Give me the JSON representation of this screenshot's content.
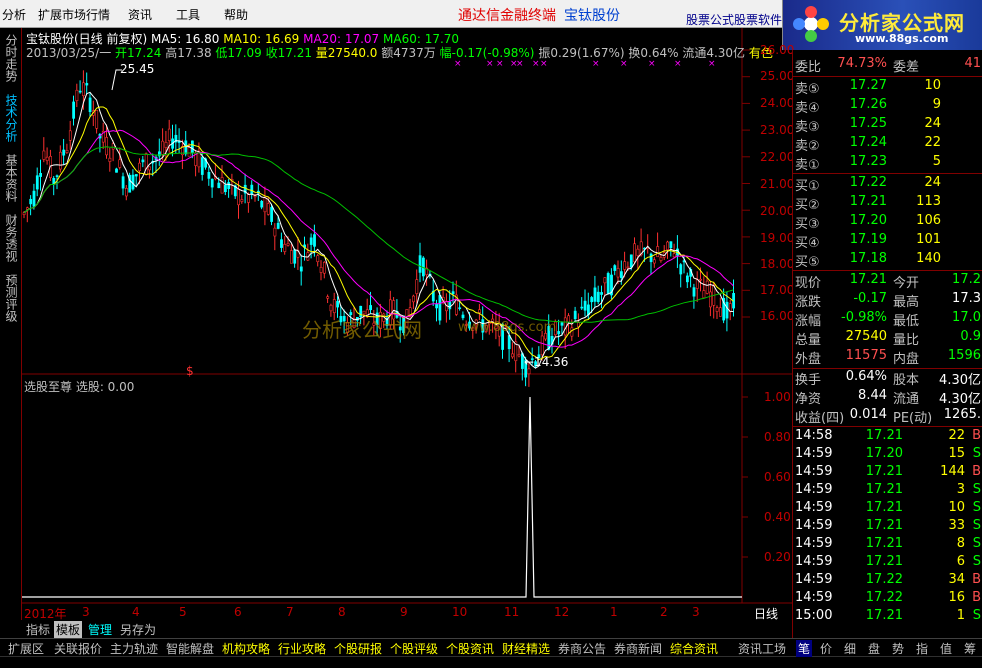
{
  "menu": {
    "items": [
      "分析",
      "扩展市场行情",
      "资讯",
      "工具",
      "帮助"
    ],
    "center_title": "通达信金融终端",
    "stock_name": "宝钛股份",
    "ad_text": "股票公式股票软件",
    "logo_text": "分析家公式网",
    "logo_url": "www.88gs.com"
  },
  "left_tabs": [
    "分时走势",
    "技术分析",
    "基本资料",
    "财务透视",
    "预测评级"
  ],
  "left_tab_active": 1,
  "chart_header": {
    "title": "宝钛股份(日线 前复权)",
    "ma5": "MA5: 16.80",
    "ma10": "MA10: 16.69",
    "ma20": "MA20: 17.07",
    "ma60": "MA60: 17.70",
    "date": "2013/03/25/一",
    "open": "开17.24",
    "high": "高17.38",
    "low": "低17.09",
    "close": "收17.21",
    "volume": "量27540.0",
    "amount": "额4737万",
    "change": "幅-0.17(-0.98%)",
    "amplitude": "振0.29(1.67%)",
    "turnover": "换0.64%",
    "float": "流通4.30亿",
    "sector": "有色"
  },
  "price_axis": [
    "26.00",
    "25.00",
    "24.00",
    "23.00",
    "22.00",
    "21.00",
    "20.00",
    "19.00",
    "18.00",
    "17.00",
    "16.00"
  ],
  "indicator_axis": [
    "1.00",
    "0.80",
    "0.60",
    "0.40",
    "0.20"
  ],
  "annotations": {
    "high_label": "25.45",
    "low_label": "←14.36",
    "dollar_mark": "$"
  },
  "watermark": "分析家公式网",
  "watermark_url": "www.88gs.com",
  "indicator_label": "选股至尊  选股: 0.00",
  "time_axis": [
    "2012年",
    "3",
    "4",
    "5",
    "6",
    "7",
    "8",
    "9",
    "10",
    "11",
    "12",
    "1",
    "2",
    "3"
  ],
  "period_label": "日线",
  "bottom_tabs": [
    "指标",
    "模板",
    "管理",
    "另存为"
  ],
  "bottom_tab_active": 1,
  "bottom_tab_highlight": 2,
  "bottom_nav": [
    "扩展区",
    "关联报价",
    "主力轨迹",
    "智能解盘",
    "机构攻略",
    "行业攻略",
    "个股研报",
    "个股评级",
    "个股资讯",
    "财经精选",
    "券商公告",
    "券商新闻",
    "综合资讯",
    "资讯工场"
  ],
  "order_book": {
    "weibi_label": "委比",
    "weibi_value": "74.73%",
    "weicha_label": "委差",
    "weicha_value": "41",
    "asks": [
      {
        "label": "卖⑤",
        "price": "17.27",
        "vol": "10"
      },
      {
        "label": "卖④",
        "price": "17.26",
        "vol": "9"
      },
      {
        "label": "卖③",
        "price": "17.25",
        "vol": "24"
      },
      {
        "label": "卖②",
        "price": "17.24",
        "vol": "22"
      },
      {
        "label": "卖①",
        "price": "17.23",
        "vol": "5"
      }
    ],
    "bids": [
      {
        "label": "买①",
        "price": "17.22",
        "vol": "24"
      },
      {
        "label": "买②",
        "price": "17.21",
        "vol": "113"
      },
      {
        "label": "买③",
        "price": "17.20",
        "vol": "106"
      },
      {
        "label": "买④",
        "price": "17.19",
        "vol": "101"
      },
      {
        "label": "买⑤",
        "price": "17.18",
        "vol": "140"
      }
    ]
  },
  "quote": [
    {
      "l1": "现价",
      "v1": "17.21",
      "c1": "#00ff00",
      "l2": "今开",
      "v2": "17.2",
      "c2": "#00ff00"
    },
    {
      "l1": "涨跌",
      "v1": "-0.17",
      "c1": "#00ff00",
      "l2": "最高",
      "v2": "17.3",
      "c2": "#ffffff"
    },
    {
      "l1": "涨幅",
      "v1": "-0.98%",
      "c1": "#00ff00",
      "l2": "最低",
      "v2": "17.0",
      "c2": "#00ff00"
    },
    {
      "l1": "总量",
      "v1": "27540",
      "c1": "#ffff00",
      "l2": "量比",
      "v2": "0.9",
      "c2": "#00ff00"
    },
    {
      "l1": "外盘",
      "v1": "11575",
      "c1": "#ff5050",
      "l2": "内盘",
      "v2": "1596",
      "c2": "#00ff00"
    }
  ],
  "fundamentals": [
    {
      "l1": "换手",
      "v1": "0.64%",
      "l2": "股本",
      "v2": "4.30亿"
    },
    {
      "l1": "净资",
      "v1": "8.44",
      "l2": "流通",
      "v2": "4.30亿"
    },
    {
      "l1": "收益(四)",
      "v1": "0.014",
      "l2": "PE(动)",
      "v2": "1265."
    }
  ],
  "ticks": [
    {
      "time": "14:58",
      "price": "17.21",
      "vol": "22",
      "side": "B",
      "side_color": "#ff5050"
    },
    {
      "time": "14:59",
      "price": "17.20",
      "vol": "15",
      "side": "S",
      "side_color": "#00ff00"
    },
    {
      "time": "14:59",
      "price": "17.21",
      "vol": "144",
      "side": "B",
      "side_color": "#ff5050"
    },
    {
      "time": "14:59",
      "price": "17.21",
      "vol": "3",
      "side": "S",
      "side_color": "#00ff00"
    },
    {
      "time": "14:59",
      "price": "17.21",
      "vol": "10",
      "side": "S",
      "side_color": "#00ff00"
    },
    {
      "time": "14:59",
      "price": "17.21",
      "vol": "33",
      "side": "S",
      "side_color": "#00ff00"
    },
    {
      "time": "14:59",
      "price": "17.21",
      "vol": "8",
      "side": "S",
      "side_color": "#00ff00"
    },
    {
      "time": "14:59",
      "price": "17.21",
      "vol": "6",
      "side": "S",
      "side_color": "#00ff00"
    },
    {
      "time": "14:59",
      "price": "17.22",
      "vol": "34",
      "side": "B",
      "side_color": "#ff5050"
    },
    {
      "time": "14:59",
      "price": "17.22",
      "vol": "16",
      "side": "B",
      "side_color": "#ff5050"
    },
    {
      "time": "15:00",
      "price": "17.21",
      "vol": "1",
      "side": "S",
      "side_color": "#00ff00"
    }
  ],
  "right_tabs": [
    "笔",
    "价",
    "细",
    "盘",
    "势",
    "指",
    "值",
    "筹"
  ],
  "right_tab_active": 0,
  "chart_data": {
    "type": "candlestick",
    "ylim": [
      14,
      26.5
    ],
    "high_point": 25.45,
    "low_point": 14.36,
    "indicator": {
      "name": "选股至尊",
      "ylim": [
        0,
        1.1
      ],
      "spike_value": 1.0
    }
  }
}
